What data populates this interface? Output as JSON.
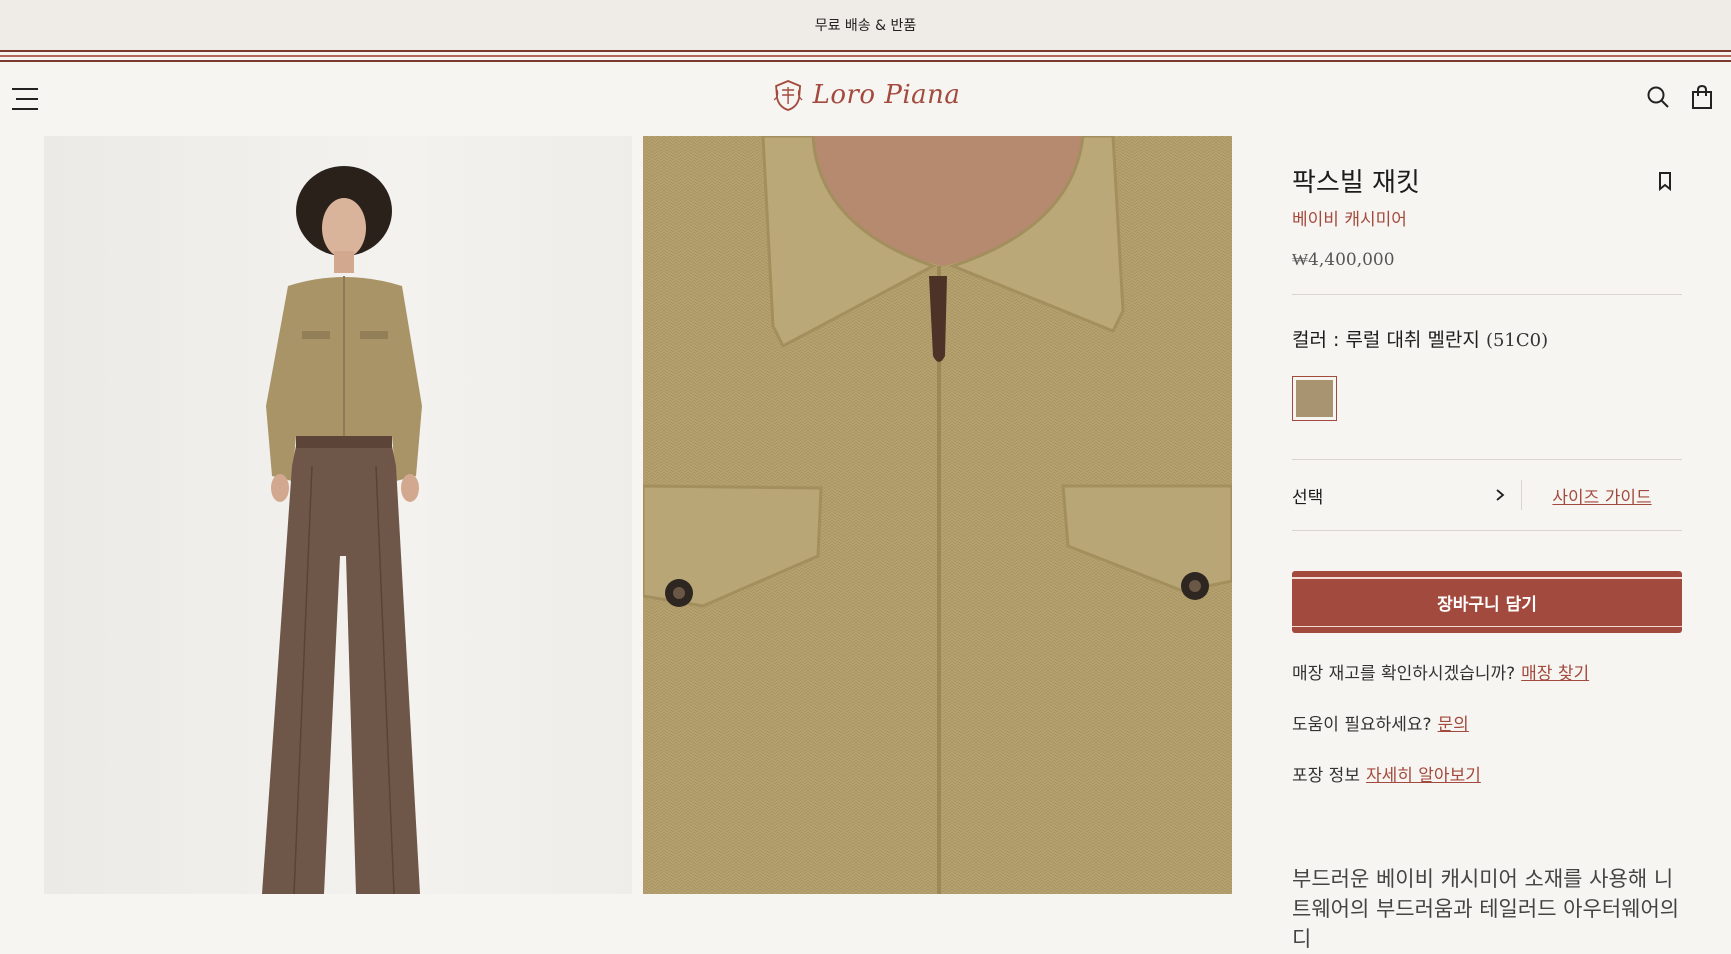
{
  "promo": {
    "text": "무료 배송 & 반품"
  },
  "header": {
    "brand": "Loro Piana"
  },
  "product": {
    "title": "팍스빌 재킷",
    "material": "베이비 캐시미어",
    "price": "₩4,400,000",
    "color_label": "컬러 : 루럴 대취 멜란지",
    "color_code": "(51C0)",
    "select_label": "선택",
    "size_guide": "사이즈 가이드",
    "add_to_cart": "장바구니 담기",
    "store_question": "매장 재고를 확인하시겠습니까?",
    "store_link": "매장 찾기",
    "help_question": "도움이 필요하세요?",
    "help_link": "문의",
    "packaging_label": "포장 정보",
    "packaging_link": "자세히 알아보기",
    "description": "부드러운 베이비 캐시미어 소재를 사용해 니트웨어의 부드러움과 테일러드 아우터웨어의 디"
  },
  "colors": {
    "accent": "#a34a3e",
    "swatch": "#a89470"
  }
}
